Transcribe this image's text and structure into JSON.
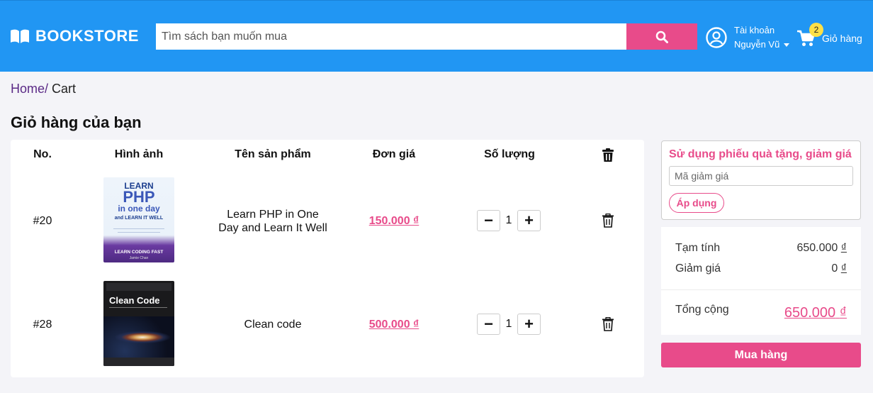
{
  "brand": {
    "name": "BOOKSTORE"
  },
  "search": {
    "placeholder": "Tìm sách bạn muốn mua"
  },
  "account": {
    "label": "Tài khoản",
    "username": "Nguyễn Vũ"
  },
  "cart_link": {
    "count": "2",
    "label": "Giỏ hàng"
  },
  "breadcrumb": {
    "home": "Home",
    "separator": "/",
    "current": "Cart"
  },
  "page_title": "Giỏ hàng của bạn",
  "table": {
    "headers": {
      "no": "No.",
      "image": "Hình ảnh",
      "name": "Tên sản phẩm",
      "price": "Đơn giá",
      "quantity": "Số lượng"
    },
    "rows": [
      {
        "no": "#20",
        "name_line1": "Learn PHP in One",
        "name_line2": "Day and Learn It Well",
        "price": "150.000 ₫",
        "quantity": "1",
        "cover": {
          "line1": "LEARN",
          "line2": "PHP",
          "line3": "in one day",
          "line4": "and LEARN IT WELL",
          "bottom": "LEARN CODING FAST",
          "author": "Jamie Chan"
        }
      },
      {
        "no": "#28",
        "name_line1": "Clean code",
        "name_line2": "",
        "price": "500.000 ₫",
        "quantity": "1",
        "cover": {
          "line1": "Clean Code"
        }
      }
    ]
  },
  "voucher": {
    "title": "Sử dụng phiếu quà tặng, giảm giá",
    "placeholder": "Mã giảm giá",
    "apply_label": "Áp dụng"
  },
  "summary": {
    "subtotal_label": "Tạm tính",
    "subtotal_value": "650.000",
    "currency": "₫",
    "discount_label": "Giảm giá",
    "discount_value": "0",
    "total_label": "Tổng cộng",
    "total_value": "650.000"
  },
  "checkout_label": "Mua hàng",
  "colors": {
    "header": "#2196f3",
    "accent": "#e84b8a",
    "badge": "#fde047"
  }
}
